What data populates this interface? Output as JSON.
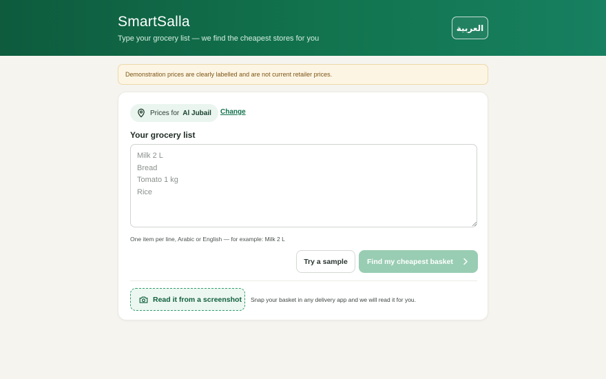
{
  "header": {
    "brand": "SmartSalla",
    "tagline": "Type your grocery list — we find the cheapest stores for you",
    "language_button": "العربية"
  },
  "notice": {
    "text": "Demonstration prices are clearly labelled and are not current retailer prices."
  },
  "location": {
    "icon": "map-pin-icon",
    "prefix": "Prices for",
    "city": "Al Jubail",
    "change_label": "Change"
  },
  "grocery_list": {
    "title": "Your grocery list",
    "value": "",
    "placeholder": "Milk 2 L\nBread\nTomato 1 kg\nRice",
    "hint": "One item per line, Arabic or English — for example: Milk 2 L"
  },
  "actions": {
    "sample_label": "Try a sample",
    "find_label": "Find my cheapest basket",
    "find_icon": "chevron-right-icon"
  },
  "screenshot": {
    "button_label": "Read it from a screenshot",
    "button_icon": "camera-icon",
    "description": "Snap your basket in any delivery app and we will read it for you."
  },
  "colors": {
    "brand_green": "#0e5b3e",
    "accent_green": "#11704b",
    "disabled_button": "#99cdb3",
    "notice_bg": "#fdf5e4",
    "page_bg": "#f5f4ef"
  }
}
